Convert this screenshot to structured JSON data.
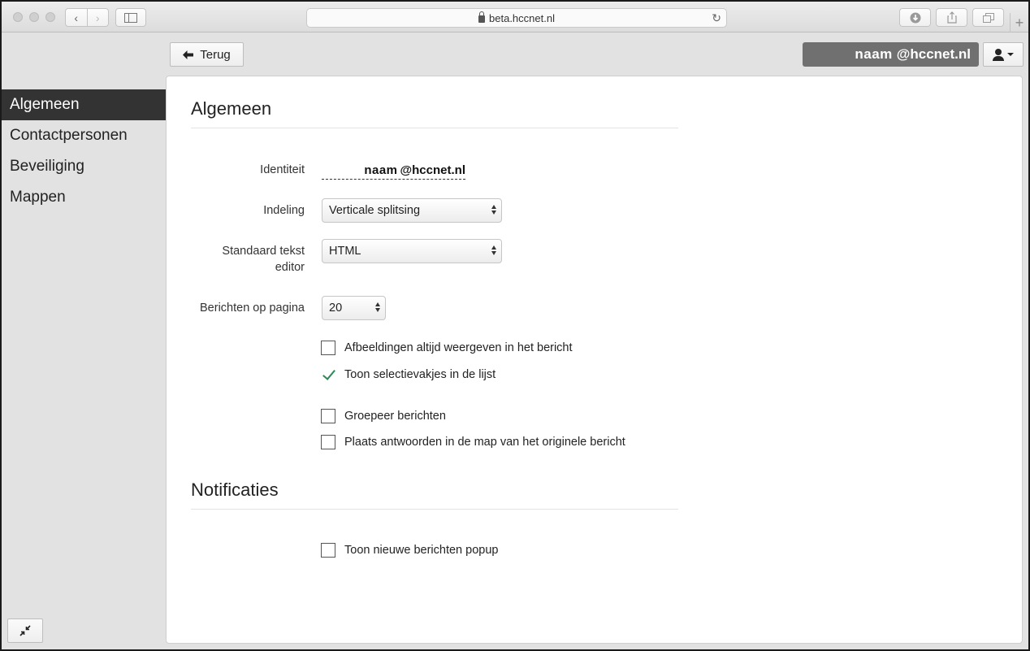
{
  "browser": {
    "url": "beta.hccnet.nl"
  },
  "topbar": {
    "back_label": "Terug",
    "account_name": "naam",
    "account_domain": "@hccnet.nl"
  },
  "sidebar": {
    "items": [
      {
        "label": "Algemeen",
        "active": true
      },
      {
        "label": "Contactpersonen",
        "active": false
      },
      {
        "label": "Beveiliging",
        "active": false
      },
      {
        "label": "Mappen",
        "active": false
      }
    ]
  },
  "general": {
    "title": "Algemeen",
    "identity_label": "Identiteit",
    "identity_name": "naam",
    "identity_domain": "@hccnet.nl",
    "layout_label": "Indeling",
    "layout_value": "Verticale splitsing",
    "editor_label_line1": "Standaard tekst",
    "editor_label_line2": "editor",
    "editor_value": "HTML",
    "per_page_label": "Berichten op pagina",
    "per_page_value": "20",
    "options": [
      {
        "label": "Afbeeldingen altijd weergeven in het bericht",
        "checked": false
      },
      {
        "label": "Toon selectievakjes in de lijst",
        "checked": true
      },
      {
        "label": "Groepeer berichten",
        "checked": false
      },
      {
        "label": "Plaats antwoorden in de map van het originele bericht",
        "checked": false
      }
    ]
  },
  "notifications": {
    "title": "Notificaties",
    "options": [
      {
        "label": "Toon nieuwe berichten popup",
        "checked": false
      }
    ]
  },
  "colors": {
    "sidebar_active_bg": "#333333",
    "account_pill_bg": "#707070",
    "check_green": "#2e8b57"
  }
}
